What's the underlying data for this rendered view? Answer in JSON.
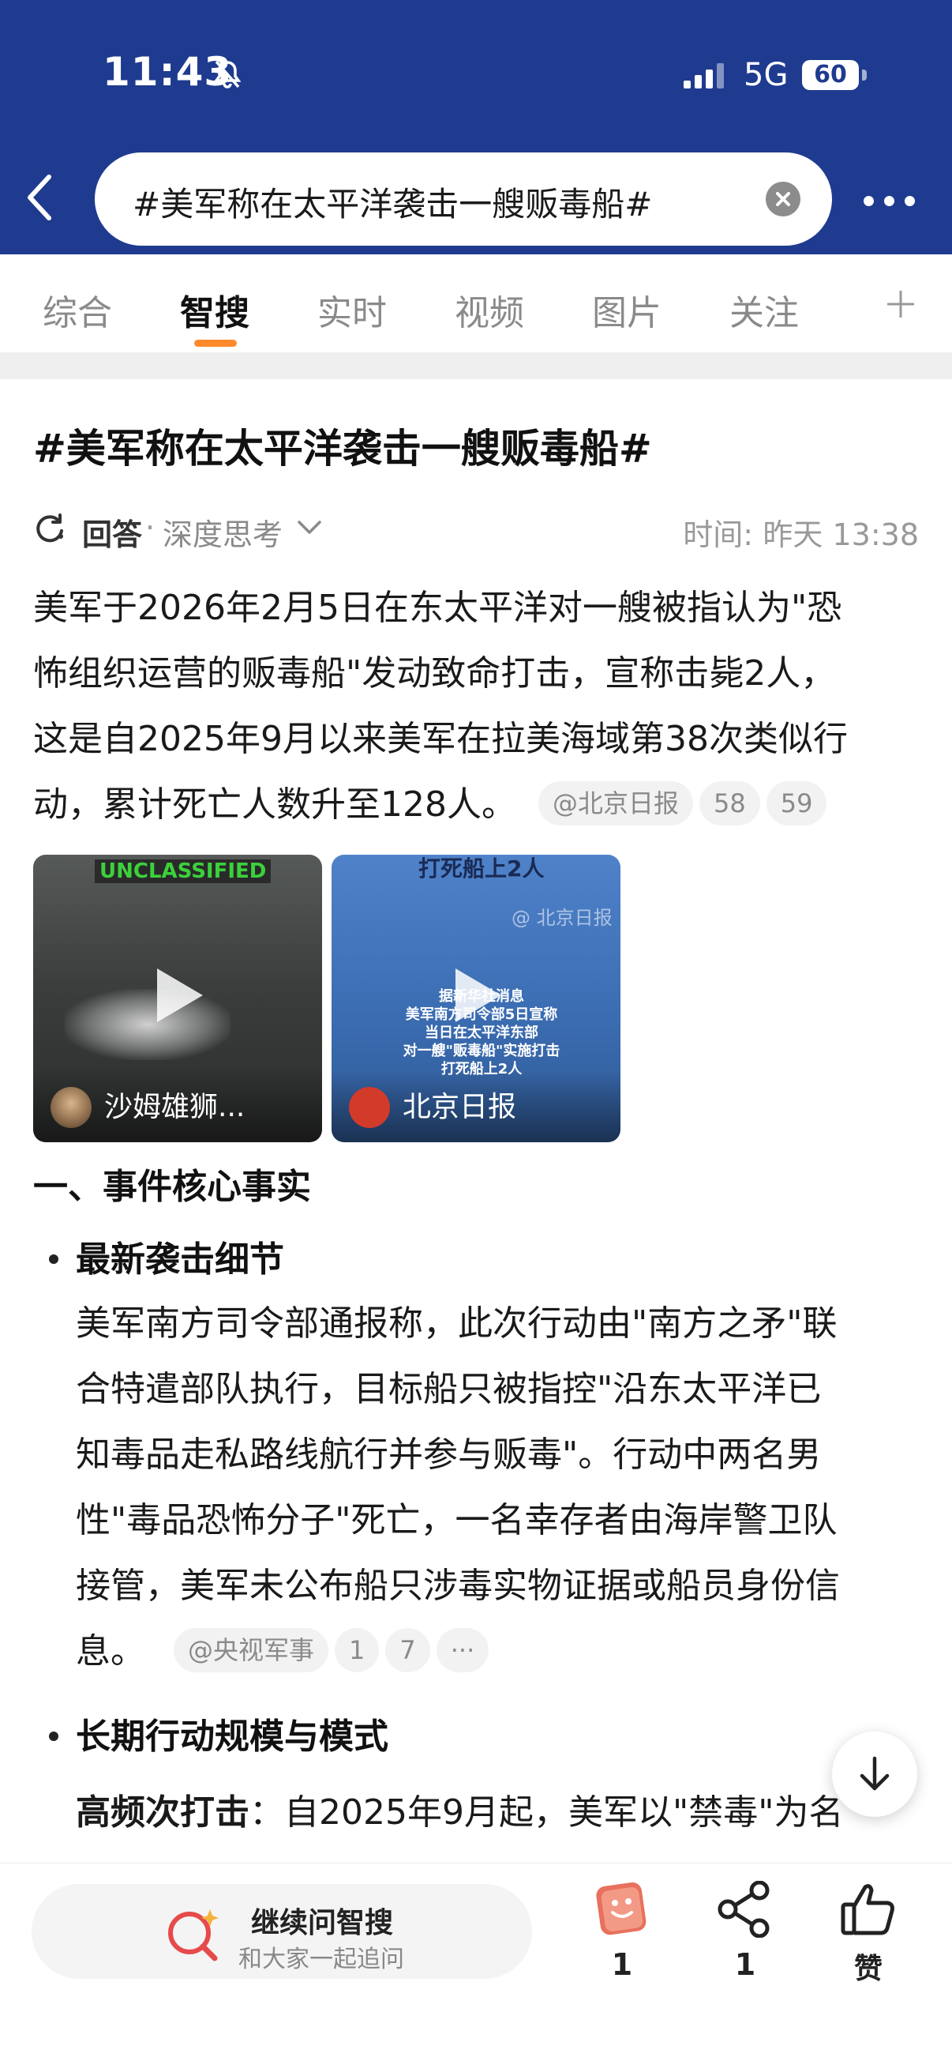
{
  "status_bar": {
    "time": "11:43",
    "network": "5G",
    "battery": "60"
  },
  "header": {
    "search_query": "#美军称在太平洋袭击一艘贩毒船#"
  },
  "tabs": [
    {
      "label": "综合"
    },
    {
      "label": "智搜"
    },
    {
      "label": "实时"
    },
    {
      "label": "视频"
    },
    {
      "label": "图片"
    },
    {
      "label": "关注"
    }
  ],
  "active_tab": "智搜",
  "article": {
    "title": "#美军称在太平洋袭击一艘贩毒船#",
    "answer_label": "回答",
    "separator": "·",
    "mode_label": "深度思考",
    "time_label": "时间:",
    "time_value": "昨天 13:38",
    "intro": {
      "lines": [
        "美军于2026年2月5日在东太平洋对一艘被指认为\"恐",
        "怖组织运营的贩毒船\"发动致命打击，宣称击毙2人，",
        "这是自2025年9月以来美军在拉美海域第38次类似行",
        "动，累计死亡人数升至128人。"
      ],
      "source": "@北京日报",
      "refs": [
        "58",
        "59"
      ]
    },
    "videos": [
      {
        "badge": "UNCLASSIFIED",
        "name": "沙姆雄狮..."
      },
      {
        "top_text": "打死船上2人",
        "watermark": "@ 北京日报",
        "subtitle_lines": [
          "据新华社消息",
          "美军南方司令部5日宣称",
          "当日在太平洋东部",
          "对一艘\"贩毒船\"实施打击",
          "打死船上2人"
        ],
        "name": "北京日报"
      }
    ],
    "section1_title": "一、事件核心事实",
    "bullet1": {
      "title": "最新袭击细节",
      "lines": [
        "美军南方司令部通报称，此次行动由\"南方之矛\"联",
        "合特遣部队执行，目标船只被指控\"沿东太平洋已",
        "知毒品走私路线航行并参与贩毒\"。行动中两名男",
        "性\"毒品恐怖分子\"死亡，一名幸存者由海岸警卫队",
        "接管，美军未公布船只涉毒实物证据或船员身份信",
        "息。"
      ],
      "source": "@央视军事",
      "refs": [
        "1",
        "7"
      ],
      "more": "···"
    },
    "bullet2": {
      "title": "长期行动规模与模式",
      "lead": "高频次打击",
      "text": "：自2025年9月起，美军以\"禁毒\"为名"
    }
  },
  "bottom_bar": {
    "ask_title": "继续问智搜",
    "ask_subtitle": "和大家一起追问",
    "actions": [
      {
        "icon": "sticker-icon",
        "count": "1"
      },
      {
        "icon": "share-icon",
        "count": "1"
      },
      {
        "icon": "thumbs-up-icon",
        "label": "赞"
      }
    ]
  },
  "colors": {
    "header_bg": "#1f3b8f",
    "tab_indicator": "#ff8a2b",
    "ask_icon": "#e64a4a"
  }
}
